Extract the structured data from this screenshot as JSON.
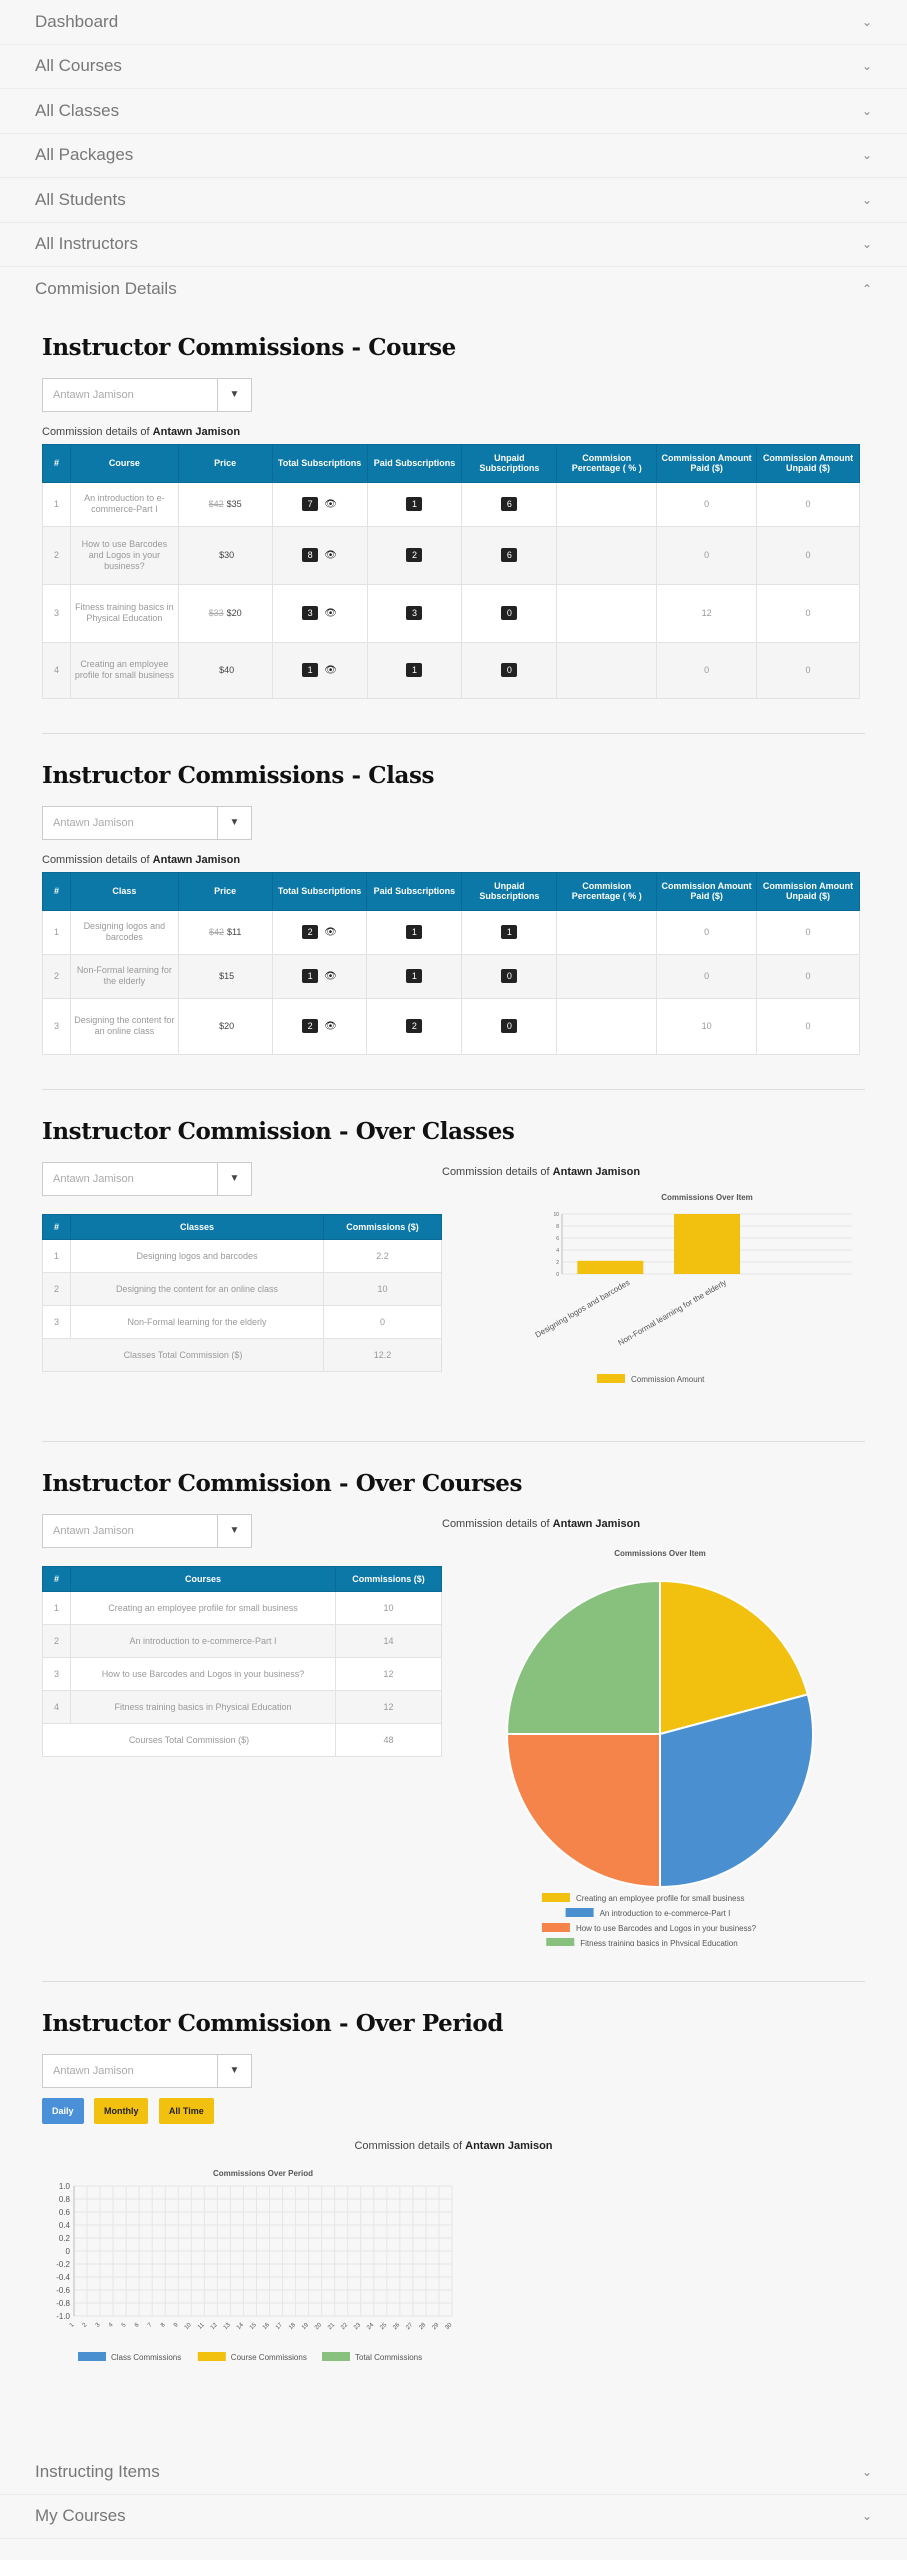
{
  "nav_top": [
    {
      "label": "Dashboard"
    },
    {
      "label": "All Courses"
    },
    {
      "label": "All Classes"
    },
    {
      "label": "All Packages"
    },
    {
      "label": "All Students"
    },
    {
      "label": "All Instructors"
    },
    {
      "label": "Commision Details"
    }
  ],
  "nav_bottom": [
    {
      "label": "Instructing Items"
    },
    {
      "label": "My Courses"
    }
  ],
  "instructor": "Antawn Jamison",
  "details_prefix": "Commission details of",
  "select_placeholder": "Antawn Jamison",
  "course_section": {
    "title": "Instructor Commissions - Course",
    "headers": [
      "#",
      "Course",
      "Price",
      "Total Subscriptions",
      "Paid Subscriptions",
      "Unpaid Subscriptions",
      "Commision Percentage ( % )",
      "Commission Amount Paid ($)",
      "Commission Amount Unpaid ($)"
    ],
    "rows": [
      {
        "n": "1",
        "name": "An introduction to e-commerce-Part I",
        "old": "$42",
        "price": "$35",
        "total": "7",
        "paid": "1",
        "unpaid": "6",
        "pct": "",
        "amt_paid": "0",
        "amt_unpaid": "0"
      },
      {
        "n": "2",
        "name": "How to use Barcodes and Logos in your business?",
        "old": "",
        "price": "$30",
        "total": "8",
        "paid": "2",
        "unpaid": "6",
        "pct": "",
        "amt_paid": "0",
        "amt_unpaid": "0"
      },
      {
        "n": "3",
        "name": "Fitness training basics in Physical Education",
        "old": "$33",
        "price": "$20",
        "total": "3",
        "paid": "3",
        "unpaid": "0",
        "pct": "",
        "amt_paid": "12",
        "amt_unpaid": "0"
      },
      {
        "n": "4",
        "name": "Creating an employee profile for small business",
        "old": "",
        "price": "$40",
        "total": "1",
        "paid": "1",
        "unpaid": "0",
        "pct": "",
        "amt_paid": "0",
        "amt_unpaid": "0"
      }
    ]
  },
  "class_section": {
    "title": "Instructor Commissions - Class",
    "headers": [
      "#",
      "Class",
      "Price",
      "Total Subscriptions",
      "Paid Subscriptions",
      "Unpaid Subscriptions",
      "Commision Percentage ( % )",
      "Commission Amount Paid ($)",
      "Commission Amount Unpaid ($)"
    ],
    "rows": [
      {
        "n": "1",
        "name": "Designing logos and barcodes",
        "old": "$42",
        "price": "$11",
        "total": "2",
        "paid": "1",
        "unpaid": "1",
        "pct": "",
        "amt_paid": "0",
        "amt_unpaid": "0"
      },
      {
        "n": "2",
        "name": "Non-Formal learning for the elderly",
        "old": "",
        "price": "$15",
        "total": "1",
        "paid": "1",
        "unpaid": "0",
        "pct": "",
        "amt_paid": "0",
        "amt_unpaid": "0"
      },
      {
        "n": "3",
        "name": "Designing the content for an online class",
        "old": "",
        "price": "$20",
        "total": "2",
        "paid": "2",
        "unpaid": "0",
        "pct": "",
        "amt_paid": "10",
        "amt_unpaid": "0"
      }
    ]
  },
  "over_classes": {
    "title": "Instructor Commission - Over Classes",
    "headers": [
      "#",
      "Classes",
      "Commissions ($)"
    ],
    "rows": [
      {
        "n": "1",
        "name": "Designing logos and barcodes",
        "value": "2.2"
      },
      {
        "n": "2",
        "name": "Designing the content for an online class",
        "value": "10"
      },
      {
        "n": "3",
        "name": "Non-Formal learning for the elderly",
        "value": "0"
      }
    ],
    "total_label": "Classes Total Commission ($)",
    "total_value": "12.2"
  },
  "over_courses": {
    "title": "Instructor Commission - Over Courses",
    "headers": [
      "#",
      "Courses",
      "Commissions ($)"
    ],
    "rows": [
      {
        "n": "1",
        "name": "Creating an employee profile for small business",
        "value": "10"
      },
      {
        "n": "2",
        "name": "An introduction to e-commerce-Part I",
        "value": "14"
      },
      {
        "n": "3",
        "name": "How to use Barcodes and Logos in your business?",
        "value": "12"
      },
      {
        "n": "4",
        "name": "Fitness training basics in Physical Education",
        "value": "12"
      }
    ],
    "total_label": "Courses Total Commission ($)",
    "total_value": "48"
  },
  "over_period": {
    "title": "Instructor Commission - Over Period",
    "buttons": [
      "Daily",
      "Monthly",
      "All Time"
    ]
  },
  "chart_data": [
    {
      "type": "bar",
      "title": "Commissions Over Item",
      "categories": [
        "Designing logos and barcodes",
        "Non-Formal learning for the elderly"
      ],
      "series": [
        {
          "name": "Commission Amount",
          "values": [
            2.2,
            10
          ],
          "color": "#f2c00f"
        }
      ],
      "ylim": [
        0,
        10
      ],
      "yticks": [
        "0",
        "2",
        "4",
        "6",
        "8",
        "10"
      ],
      "legend": "bottom"
    },
    {
      "type": "pie",
      "title": "Commissions Over Item",
      "labels": [
        "Creating an employee profile for small business",
        "An introduction to e-commerce-Part I",
        "How to use Barcodes and Logos in your business?",
        "Fitness training basics in Physical Education"
      ],
      "values": [
        10,
        14,
        12,
        12
      ],
      "colors": [
        "#f2c00f",
        "#4a90d0",
        "#f5844a",
        "#88c17e"
      ],
      "legend": "bottom"
    },
    {
      "type": "line",
      "title": "Commissions Over Period",
      "x": [
        "1",
        "2",
        "3",
        "4",
        "5",
        "6",
        "7",
        "8",
        "9",
        "10",
        "11",
        "12",
        "13",
        "14",
        "15",
        "16",
        "17",
        "18",
        "19",
        "20",
        "21",
        "22",
        "23",
        "24",
        "25",
        "26",
        "27",
        "28",
        "29",
        "30"
      ],
      "yticks": [
        "1.0",
        "0.8",
        "0.6",
        "0.4",
        "0.2",
        "0",
        "-0.2",
        "-0.4",
        "-0.6",
        "-0.8",
        "-1.0"
      ],
      "ylim": [
        -1,
        1
      ],
      "series": [
        {
          "name": "Class Commissions",
          "color": "#4a90d0",
          "values": []
        },
        {
          "name": "Course Commissions",
          "color": "#f2c00f",
          "values": []
        },
        {
          "name": "Total Commissions",
          "color": "#88c17e",
          "values": []
        }
      ],
      "legend": "bottom"
    }
  ]
}
